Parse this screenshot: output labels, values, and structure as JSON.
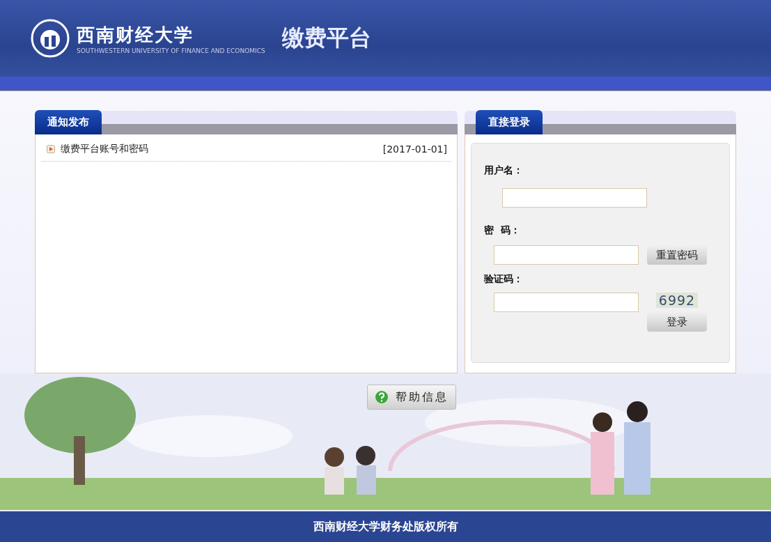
{
  "header": {
    "logo_text": "西南财经大学",
    "logo_subtext": "SOUTHWESTERN UNIVERSITY OF FINANCE AND ECONOMICS",
    "platform_title": "缴费平台"
  },
  "notice_panel": {
    "tab": "通知发布",
    "items": [
      {
        "title": "缴费平台账号和密码",
        "date": "[2017-01-01]"
      }
    ]
  },
  "login_panel": {
    "tab": "直接登录",
    "username_label": "用户名：",
    "password_label": "密  码：",
    "reset_button": "重置密码",
    "captcha_label": "验证码：",
    "captcha": "6992",
    "login_button": "登录"
  },
  "help_button": "帮助信息",
  "footer": "西南财经大学财务处版权所有"
}
